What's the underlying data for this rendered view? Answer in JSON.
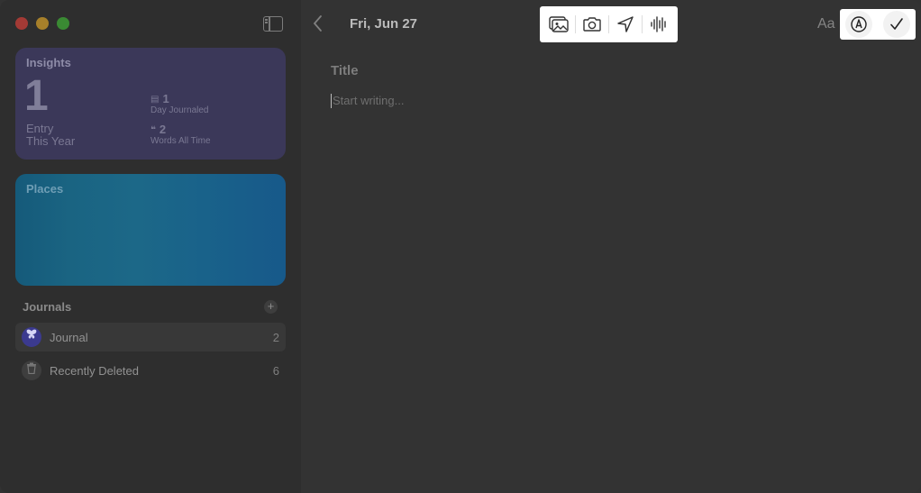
{
  "sidebar": {
    "insights": {
      "title": "Insights",
      "entry_count": "1",
      "entry_label_line1": "Entry",
      "entry_label_line2": "This Year",
      "days_journaled": "1",
      "days_journaled_label": "Day Journaled",
      "words": "2",
      "words_label": "Words All Time"
    },
    "places": {
      "title": "Places"
    },
    "journals_header": "Journals",
    "add_label": "+",
    "journals": [
      {
        "label": "Journal",
        "count": "2",
        "icon": "butterfly-icon"
      },
      {
        "label": "Recently Deleted",
        "count": "6",
        "icon": "trash-icon"
      }
    ]
  },
  "main": {
    "date_title": "Fri, Jun 27",
    "format_label": "Aa",
    "title_placeholder": "Title",
    "body_placeholder": "Start writing..."
  },
  "toolbar": {
    "icons": [
      "photo-library-icon",
      "camera-icon",
      "location-arrow-icon",
      "audio-waveform-icon"
    ]
  },
  "right_tools": {
    "icons": [
      "markup-pen-icon",
      "checkmark-icon"
    ]
  },
  "colors": {
    "insights_card": "#3b3859",
    "places_card": "#1c6888",
    "journal_icon": "#3b3a8f"
  }
}
